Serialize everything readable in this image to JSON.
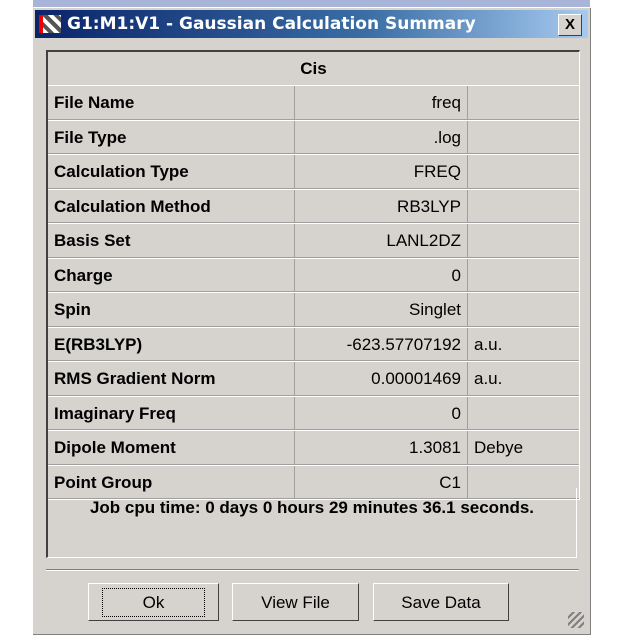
{
  "window": {
    "title": "G1:M1:V1 - Gaussian Calculation Summary",
    "close": "X"
  },
  "table": {
    "header": "Cis",
    "rows": [
      {
        "label": "File Name",
        "value": "freq",
        "unit": ""
      },
      {
        "label": "File Type",
        "value": ".log",
        "unit": ""
      },
      {
        "label": "Calculation Type",
        "value": "FREQ",
        "unit": ""
      },
      {
        "label": "Calculation Method",
        "value": "RB3LYP",
        "unit": ""
      },
      {
        "label": "Basis Set",
        "value": "LANL2DZ",
        "unit": ""
      },
      {
        "label": "Charge",
        "value": "0",
        "unit": ""
      },
      {
        "label": "Spin",
        "value": "Singlet",
        "unit": ""
      },
      {
        "label": "E(RB3LYP)",
        "value": "-623.57707192",
        "unit": "a.u."
      },
      {
        "label": "RMS Gradient Norm",
        "value": "0.00001469",
        "unit": "a.u."
      },
      {
        "label": "Imaginary Freq",
        "value": "0",
        "unit": ""
      },
      {
        "label": "Dipole Moment",
        "value": "1.3081",
        "unit": "Debye"
      },
      {
        "label": "Point Group",
        "value": "C1",
        "unit": ""
      }
    ]
  },
  "footer": "Job cpu time:  0 days  0 hours 29 minutes 36.1 seconds.",
  "buttons": {
    "ok": "Ok",
    "view": "View File",
    "save": "Save Data"
  }
}
